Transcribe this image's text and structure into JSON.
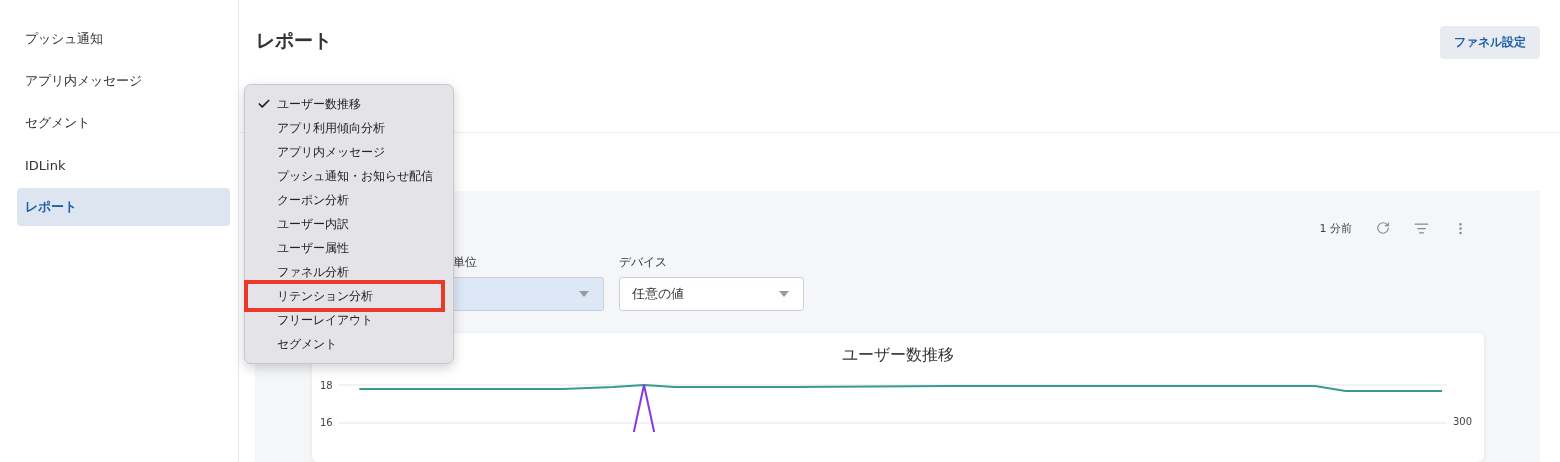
{
  "sidebar": {
    "items": [
      {
        "label": "プッシュ通知",
        "selected": false
      },
      {
        "label": "アプリ内メッセージ",
        "selected": false
      },
      {
        "label": "セグメント",
        "selected": false
      },
      {
        "label": "IDLink",
        "selected": false
      },
      {
        "label": "レポート",
        "selected": true
      }
    ]
  },
  "header": {
    "title": "レポート",
    "button": "ファネル設定"
  },
  "panel": {
    "updated": "1 分前",
    "filters": [
      {
        "label": "単位",
        "highlighted": true
      },
      {
        "label": "デバイス",
        "value": "任意の値",
        "highlighted": false
      }
    ],
    "chart": {
      "title": "ユーザー数推移",
      "left_ticks": [
        "18",
        "16"
      ],
      "right_ticks": [
        "300"
      ]
    }
  },
  "menu": {
    "items": [
      {
        "label": "ユーザー数推移",
        "checked": true,
        "outlined": false
      },
      {
        "label": "アプリ利用傾向分析",
        "checked": false,
        "outlined": false
      },
      {
        "label": "アプリ内メッセージ",
        "checked": false,
        "outlined": false
      },
      {
        "label": "プッシュ通知・お知らせ配信",
        "checked": false,
        "outlined": false
      },
      {
        "label": "クーポン分析",
        "checked": false,
        "outlined": false
      },
      {
        "label": "ユーザー内訳",
        "checked": false,
        "outlined": false
      },
      {
        "label": "ユーザー属性",
        "checked": false,
        "outlined": false
      },
      {
        "label": "ファネル分析",
        "checked": false,
        "outlined": false
      },
      {
        "label": "リテンション分析",
        "checked": false,
        "outlined": true
      },
      {
        "label": "フリーレイアウト",
        "checked": false,
        "outlined": false
      },
      {
        "label": "セグメント",
        "checked": false,
        "outlined": false
      }
    ]
  }
}
